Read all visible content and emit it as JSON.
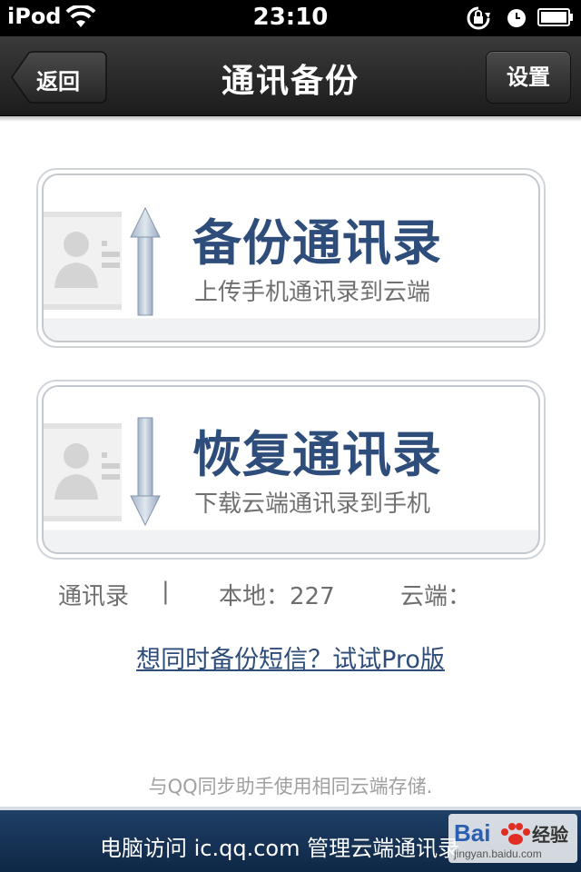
{
  "status_bar": {
    "carrier": "iPod",
    "time": "23:10",
    "icons": [
      "wifi-icon",
      "rotation-lock-icon",
      "alarm-icon",
      "battery-icon"
    ]
  },
  "nav": {
    "back_label": "返回",
    "title": "通讯备份",
    "settings_label": "设置"
  },
  "cards": {
    "backup": {
      "title": "备份通讯录",
      "subtitle": "上传手机通讯录到云端",
      "icon": "contact-upload-icon"
    },
    "restore": {
      "title": "恢复通讯录",
      "subtitle": "下载云端通讯录到手机",
      "icon": "contact-download-icon"
    }
  },
  "stats": {
    "label": "通讯录",
    "separator": "|",
    "local": "本地：227",
    "cloud": "云端："
  },
  "pro_link": "想同时备份短信？试试Pro版",
  "footer_note": "与QQ同步助手使用相同云端存储.",
  "bottom_bar": {
    "text": "电脑访问 ic.qq.com 管理云端通讯录"
  },
  "watermark": {
    "text": "Bai经验",
    "url": "jingyan.baidu.com"
  },
  "colors": {
    "nav_bg": "#2a2a2a",
    "accent_blue": "#2e4d7a",
    "bottom_bar_bg": "#15355a"
  }
}
